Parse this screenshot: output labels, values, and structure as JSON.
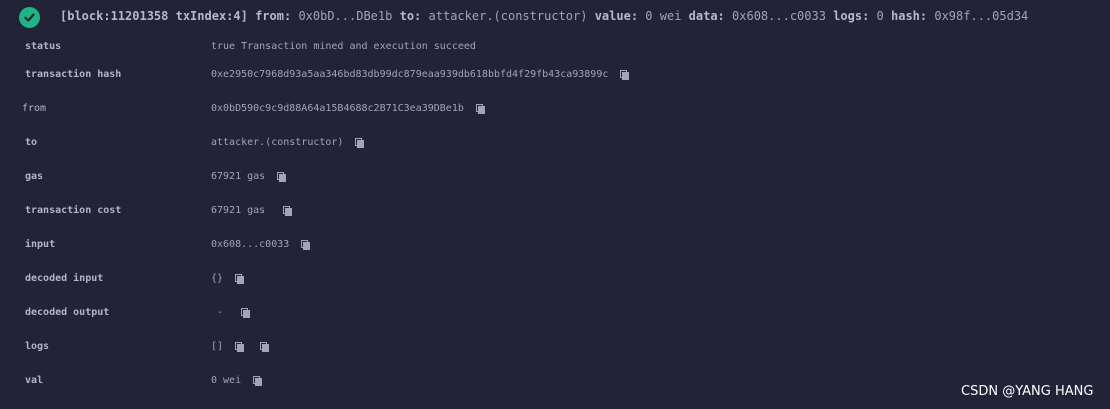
{
  "header": {
    "status_icon": "check-circle-icon",
    "block_tag": "[block:11201358 txIndex:4]",
    "from_label": "from:",
    "from_value": "0x0bD...DBe1b",
    "to_label": "to:",
    "to_value": "attacker.(constructor)",
    "value_label": "value:",
    "value_value": "0 wei",
    "data_label": "data:",
    "data_value": "0x608...c0033",
    "logs_label": "logs:",
    "logs_value": "0",
    "hash_label": "hash:",
    "hash_value": "0x98f...05d34"
  },
  "rows": [
    {
      "label": "status",
      "value": "true Transaction mined and execution succeed"
    },
    {
      "label": "transaction hash",
      "value": "0xe2950c7968d93a5aa346bd83db99dc879eaa939db618bbfd4f29fb43ca93899c",
      "copy_icon": "copy-icon"
    },
    {
      "label": "from",
      "value": "0x0bD590c9c9d88A64a15B4688c2B71C3ea39DBe1b",
      "copy_icon": "copy-icon"
    },
    {
      "label": "to",
      "value": "attacker.(constructor)",
      "copy_icon": "copy-icon"
    },
    {
      "label": "gas",
      "value": "67921 gas",
      "copy_icon": "copy-icon"
    },
    {
      "label": "transaction cost",
      "value": "67921 gas",
      "copy_icon": "copy-icon"
    },
    {
      "label": "input",
      "value": "0x608...c0033",
      "copy_icon": "copy-icon"
    },
    {
      "label": "decoded input",
      "value": "{}",
      "copy_icon": "copy-icon"
    },
    {
      "label": "decoded output",
      "value": " - ",
      "copy_icon": "copy-icon"
    },
    {
      "label": "logs",
      "value": "[]",
      "copy_icon": "copy-icon",
      "copy_icon_2": "copy-icon"
    },
    {
      "label": "val",
      "value": "0 wei",
      "copy_icon": "copy-icon"
    }
  ],
  "watermark": "CSDN @YANG HANG",
  "colors": {
    "background": "#222336",
    "text": "#a2a3bd",
    "label": "#b3b4ce",
    "success": "#1fb386"
  }
}
